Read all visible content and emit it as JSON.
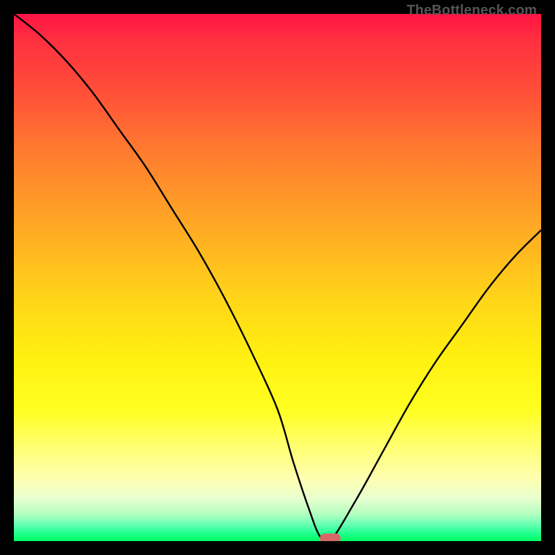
{
  "watermark": "TheBottleneck.com",
  "chart_data": {
    "type": "line",
    "title": "",
    "xlabel": "",
    "ylabel": "",
    "xlim": [
      0,
      100
    ],
    "ylim": [
      0,
      100
    ],
    "x": [
      0,
      5,
      10,
      15,
      20,
      25,
      30,
      35,
      40,
      45,
      50,
      53,
      56,
      58,
      60,
      65,
      70,
      75,
      80,
      85,
      90,
      95,
      100
    ],
    "values": [
      100,
      96,
      91,
      85,
      78,
      71,
      63,
      55,
      46,
      36,
      25,
      15,
      6,
      1,
      0,
      8,
      17,
      26,
      34,
      41,
      48,
      54,
      59
    ],
    "grid": false,
    "legend": false
  },
  "marker": {
    "x_pct": 60,
    "y_pct": 0
  },
  "gradient_stops": [
    {
      "pos": 0,
      "color": "#ff1444"
    },
    {
      "pos": 100,
      "color": "#00ff60"
    }
  ]
}
